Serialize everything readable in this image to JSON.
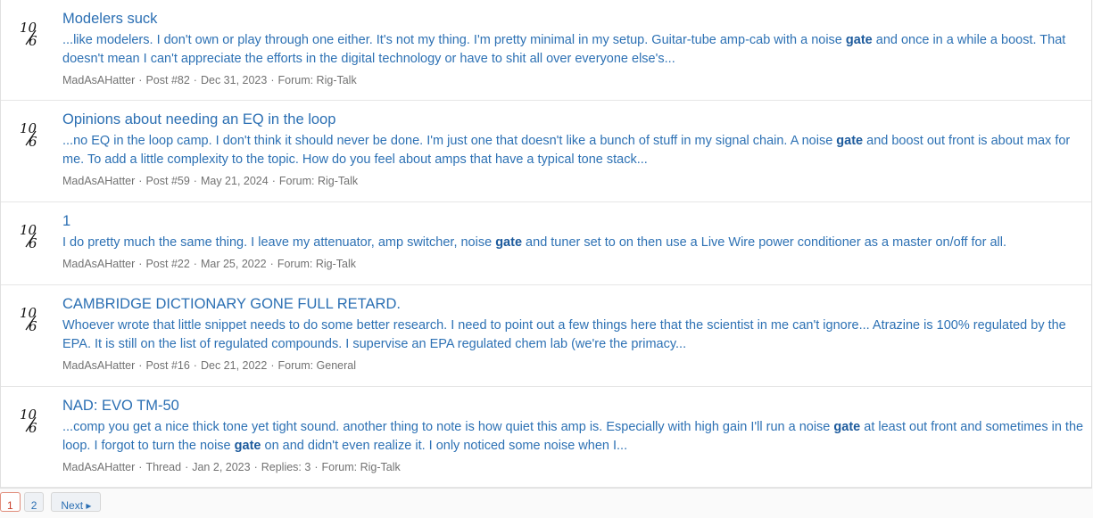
{
  "results": [
    {
      "title": "Modelers suck",
      "snippet_parts": [
        "...like modelers. I don't own or play through one either. It's not my thing. I'm pretty minimal in my setup. Guitar-tube amp-cab with a noise ",
        "gate",
        " and once in a while a boost. That doesn't mean I can't appreciate the efforts in the digital technology or have to shit all over everyone else's..."
      ],
      "meta": [
        "MadAsAHatter",
        "Post #82",
        "Dec 31, 2023",
        "Forum: Rig-Talk"
      ]
    },
    {
      "title": "Opinions about needing an EQ in the loop",
      "snippet_parts": [
        "...no EQ in the loop camp. I don't think it should never be done. I'm just one that doesn't like a bunch of stuff in my signal chain. A noise ",
        "gate",
        " and boost out front is about max for me. To add a little complexity to the topic. How do you feel about amps that have a typical tone stack..."
      ],
      "meta": [
        "MadAsAHatter",
        "Post #59",
        "May 21, 2024",
        "Forum: Rig-Talk"
      ]
    },
    {
      "title": "1",
      "snippet_parts": [
        "I do pretty much the same thing. I leave my attenuator, amp switcher, noise ",
        "gate",
        " and tuner set to on then use a Live Wire power conditioner as a master on/off for all."
      ],
      "meta": [
        "MadAsAHatter",
        "Post #22",
        "Mar 25, 2022",
        "Forum: Rig-Talk"
      ]
    },
    {
      "title": "CAMBRIDGE DICTIONARY GONE FULL RETARD.",
      "snippet_parts": [
        "Whoever wrote that little snippet needs to do some better research. I need to point out a few things here that the scientist in me can't ignore... Atrazine is 100% regulated by the EPA. It is still on the list of regulated compounds. I supervise an EPA regulated chem lab (we're the primacy..."
      ],
      "meta": [
        "MadAsAHatter",
        "Post #16",
        "Dec 21, 2022",
        "Forum: General"
      ]
    },
    {
      "title": "NAD: EVO TM-50",
      "snippet_parts": [
        "...comp you get a nice thick tone yet tight sound. another thing to note is how quiet this amp is. Especially with high gain I'll run a noise ",
        "gate",
        " at least out front and sometimes in the loop. I forgot to turn the noise ",
        "gate",
        " on and didn't even realize it. I only noticed some noise when I..."
      ],
      "meta": [
        "MadAsAHatter",
        "Thread",
        "Jan 2, 2023",
        "Replies: 3",
        "Forum: Rig-Talk"
      ]
    }
  ],
  "pagination": {
    "pages": [
      "1",
      "2"
    ],
    "current": "1",
    "next_label": "Next ▸"
  },
  "avatar_mark": "10/6",
  "colors": {
    "link": "#2b6fb3",
    "meta": "#727272",
    "current_page": "#c9402a"
  }
}
